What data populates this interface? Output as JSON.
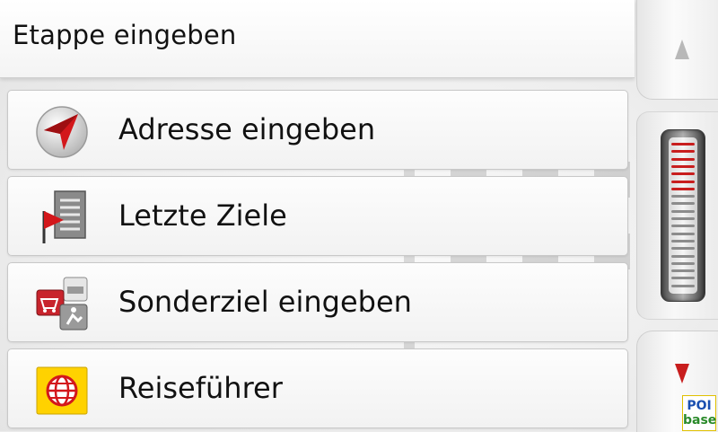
{
  "header": {
    "title": "Etappe eingeben"
  },
  "menu": {
    "items": [
      {
        "label": "Adresse eingeben",
        "icon": "navigation-arrow-icon"
      },
      {
        "label": "Letzte Ziele",
        "icon": "recent-destinations-flag-icon"
      },
      {
        "label": "Sonderziel eingeben",
        "icon": "points-of-interest-icon"
      },
      {
        "label": "Reiseführer",
        "icon": "travel-guide-globe-icon"
      }
    ]
  },
  "scrollbar": {
    "position": 0,
    "active_color": "#c81e1e",
    "inactive_color": "#8c8c8c"
  },
  "badge": {
    "line1": "POI",
    "line2": "base"
  }
}
